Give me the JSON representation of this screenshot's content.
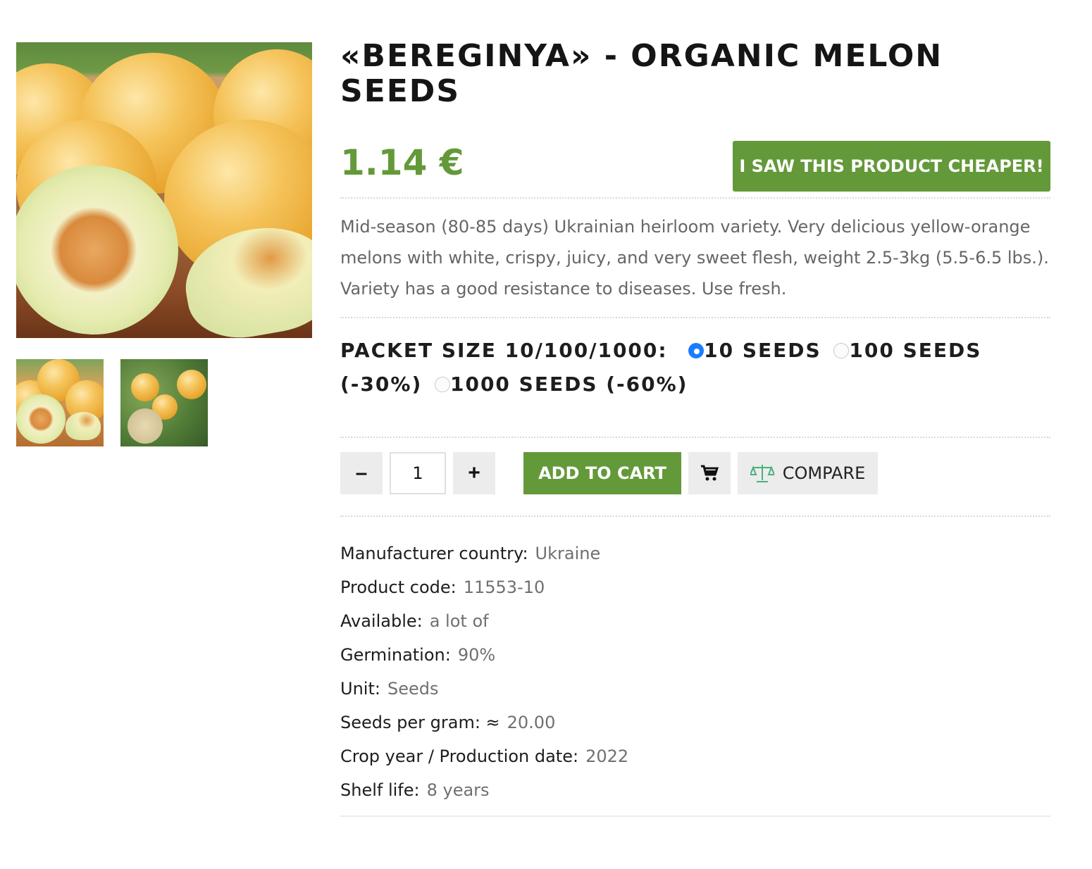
{
  "product": {
    "title": "«BEREGINYA» - ORGANIC MELON SEEDS",
    "price": "1.14 €",
    "cheaper_button": "I SAW THIS PRODUCT CHEAPER!",
    "description": "Mid-season (80-85 days) Ukrainian heirloom variety. Very delicious yellow-orange melons with white, crispy, juicy, and very sweet flesh, weight 2.5-3kg (5.5-6.5 lbs.). Variety has a good resistance to diseases. Use fresh."
  },
  "gallery": {
    "main_image": "melon-main-image",
    "thumbnails": [
      "melon-thumbnail-1",
      "melon-thumbnail-2"
    ]
  },
  "packet": {
    "label": "PACKET SIZE 10/100/1000:",
    "options": [
      {
        "label": "10 SEEDS",
        "checked": true
      },
      {
        "label": "100 SEEDS (-30%)",
        "checked": false
      },
      {
        "label": "1000 SEEDS (-60%)",
        "checked": false
      }
    ]
  },
  "cart": {
    "minus": "–",
    "quantity": "1",
    "plus": "+",
    "add_to_cart": "ADD TO CART",
    "cart_icon": "cart-icon",
    "compare_icon": "scales-icon",
    "compare": "COMPARE"
  },
  "specs": [
    {
      "label": "Manufacturer country:",
      "value": "Ukraine"
    },
    {
      "label": "Product code:",
      "value": "11553-10"
    },
    {
      "label": "Available:",
      "value": "a lot of"
    },
    {
      "label": "Germination:",
      "value": "90%"
    },
    {
      "label": "Unit:",
      "value": "Seeds"
    },
    {
      "label": "Seeds per gram: ≈",
      "value": "20.00"
    },
    {
      "label": "Crop year / Production date:",
      "value": "2022"
    },
    {
      "label": "Shelf life:",
      "value": "8 years"
    }
  ],
  "colors": {
    "accent_green": "#64993a",
    "radio_checked": "#1a7dff",
    "muted_text": "#707070"
  }
}
